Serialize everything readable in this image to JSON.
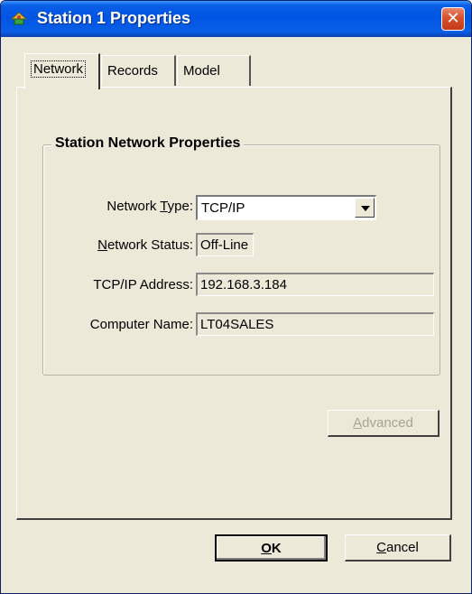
{
  "window": {
    "title": "Station 1 Properties",
    "title_icon": "network-station-icon",
    "close_icon": "close-icon"
  },
  "tabs": [
    {
      "label": "Network",
      "active": true
    },
    {
      "label": "Records",
      "active": false
    },
    {
      "label": "Model",
      "active": false
    }
  ],
  "group": {
    "title": "Station Network Properties",
    "network_type": {
      "label_pre": "Network ",
      "label_key": "T",
      "label_post": "ype:",
      "value": "TCP/IP"
    },
    "network_status": {
      "label_key": "N",
      "label_post": "etwork Status:",
      "value": "Off-Line"
    },
    "tcpip_address": {
      "label": "TCP/IP Address:",
      "value": "192.168.3.184"
    },
    "computer_name": {
      "label": "Computer Name:",
      "value": "LT04SALES"
    }
  },
  "buttons": {
    "advanced": {
      "label_key": "A",
      "label_post": "dvanced",
      "enabled": false
    },
    "ok": {
      "label_key": "O",
      "label_post": "K"
    },
    "cancel": {
      "label_key": "C",
      "label_post": "ancel"
    }
  }
}
